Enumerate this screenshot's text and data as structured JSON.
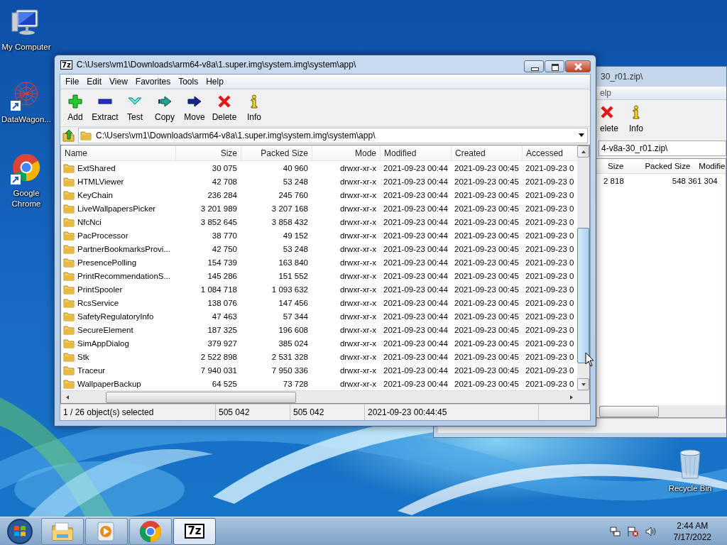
{
  "desktop_icons": [
    {
      "label": "My Computer",
      "kind": "computer"
    },
    {
      "label": "DataWagon...",
      "kind": "datawagon"
    },
    {
      "label": "Google Chrome",
      "kind": "chrome"
    },
    {
      "label": "Recycle Bin",
      "kind": "recycle"
    }
  ],
  "back_window": {
    "title": "30_r01.zip\\",
    "menu": [
      "elp"
    ],
    "toolbar": [
      {
        "label": "elete",
        "kind": "delete"
      },
      {
        "label": "Info",
        "kind": "info"
      }
    ],
    "address": "4-v8a-30_r01.zip\\",
    "columns": [
      "Size",
      "Packed Size",
      "Modifie"
    ],
    "rows": [
      [
        "2 818",
        "548 361 304"
      ]
    ]
  },
  "window": {
    "logo": "7z",
    "title": "C:\\Users\\vm1\\Downloads\\arm64-v8a\\1.super.img\\system.img\\system\\app\\",
    "menu": [
      "File",
      "Edit",
      "View",
      "Favorites",
      "Tools",
      "Help"
    ],
    "toolbar": [
      {
        "label": "Add",
        "kind": "add"
      },
      {
        "label": "Extract",
        "kind": "extract"
      },
      {
        "label": "Test",
        "kind": "test"
      },
      {
        "label": "Copy",
        "kind": "copy"
      },
      {
        "label": "Move",
        "kind": "move"
      },
      {
        "label": "Delete",
        "kind": "delete"
      },
      {
        "label": "Info",
        "kind": "info"
      }
    ],
    "address": "C:\\Users\\vm1\\Downloads\\arm64-v8a\\1.super.img\\system.img\\system\\app\\",
    "columns": [
      "Name",
      "Size",
      "Packed Size",
      "Mode",
      "Modified",
      "Created",
      "Accessed"
    ],
    "rows": [
      {
        "name": "ExtShared",
        "size": "30 075",
        "packed_size": "40 960",
        "mode": "drwxr-xr-x",
        "modified": "2021-09-23 00:44",
        "created": "2021-09-23 00:45",
        "accessed": "2021-09-23 0"
      },
      {
        "name": "HTMLViewer",
        "size": "42 708",
        "packed_size": "53 248",
        "mode": "drwxr-xr-x",
        "modified": "2021-09-23 00:44",
        "created": "2021-09-23 00:45",
        "accessed": "2021-09-23 0"
      },
      {
        "name": "KeyChain",
        "size": "236 284",
        "packed_size": "245 760",
        "mode": "drwxr-xr-x",
        "modified": "2021-09-23 00:44",
        "created": "2021-09-23 00:45",
        "accessed": "2021-09-23 0"
      },
      {
        "name": "LiveWallpapersPicker",
        "size": "3 201 989",
        "packed_size": "3 207 168",
        "mode": "drwxr-xr-x",
        "modified": "2021-09-23 00:44",
        "created": "2021-09-23 00:45",
        "accessed": "2021-09-23 0"
      },
      {
        "name": "NfcNci",
        "size": "3 852 645",
        "packed_size": "3 858 432",
        "mode": "drwxr-xr-x",
        "modified": "2021-09-23 00:44",
        "created": "2021-09-23 00:45",
        "accessed": "2021-09-23 0"
      },
      {
        "name": "PacProcessor",
        "size": "38 770",
        "packed_size": "49 152",
        "mode": "drwxr-xr-x",
        "modified": "2021-09-23 00:44",
        "created": "2021-09-23 00:45",
        "accessed": "2021-09-23 0"
      },
      {
        "name": "PartnerBookmarksProvi...",
        "size": "42 750",
        "packed_size": "53 248",
        "mode": "drwxr-xr-x",
        "modified": "2021-09-23 00:44",
        "created": "2021-09-23 00:45",
        "accessed": "2021-09-23 0"
      },
      {
        "name": "PresencePolling",
        "size": "154 739",
        "packed_size": "163 840",
        "mode": "drwxr-xr-x",
        "modified": "2021-09-23 00:44",
        "created": "2021-09-23 00:45",
        "accessed": "2021-09-23 0"
      },
      {
        "name": "PrintRecommendationS...",
        "size": "145 286",
        "packed_size": "151 552",
        "mode": "drwxr-xr-x",
        "modified": "2021-09-23 00:44",
        "created": "2021-09-23 00:45",
        "accessed": "2021-09-23 0"
      },
      {
        "name": "PrintSpooler",
        "size": "1 084 718",
        "packed_size": "1 093 632",
        "mode": "drwxr-xr-x",
        "modified": "2021-09-23 00:44",
        "created": "2021-09-23 00:45",
        "accessed": "2021-09-23 0"
      },
      {
        "name": "RcsService",
        "size": "138 076",
        "packed_size": "147 456",
        "mode": "drwxr-xr-x",
        "modified": "2021-09-23 00:44",
        "created": "2021-09-23 00:45",
        "accessed": "2021-09-23 0"
      },
      {
        "name": "SafetyRegulatoryInfo",
        "size": "47 463",
        "packed_size": "57 344",
        "mode": "drwxr-xr-x",
        "modified": "2021-09-23 00:44",
        "created": "2021-09-23 00:45",
        "accessed": "2021-09-23 0"
      },
      {
        "name": "SecureElement",
        "size": "187 325",
        "packed_size": "196 608",
        "mode": "drwxr-xr-x",
        "modified": "2021-09-23 00:44",
        "created": "2021-09-23 00:45",
        "accessed": "2021-09-23 0"
      },
      {
        "name": "SimAppDialog",
        "size": "379 927",
        "packed_size": "385 024",
        "mode": "drwxr-xr-x",
        "modified": "2021-09-23 00:44",
        "created": "2021-09-23 00:45",
        "accessed": "2021-09-23 0"
      },
      {
        "name": "Stk",
        "size": "2 522 898",
        "packed_size": "2 531 328",
        "mode": "drwxr-xr-x",
        "modified": "2021-09-23 00:44",
        "created": "2021-09-23 00:45",
        "accessed": "2021-09-23 0"
      },
      {
        "name": "Traceur",
        "size": "7 940 031",
        "packed_size": "7 950 336",
        "mode": "drwxr-xr-x",
        "modified": "2021-09-23 00:44",
        "created": "2021-09-23 00:45",
        "accessed": "2021-09-23 0"
      },
      {
        "name": "WallpaperBackup",
        "size": "64 525",
        "packed_size": "73 728",
        "mode": "drwxr-xr-x",
        "modified": "2021-09-23 00:44",
        "created": "2021-09-23 00:45",
        "accessed": "2021-09-23 0"
      }
    ],
    "status": [
      "1 / 26 object(s) selected",
      "505 042",
      "505 042",
      "2021-09-23 00:44:45"
    ]
  },
  "taskbar": {
    "apps": [
      {
        "kind": "explorer",
        "selected": false
      },
      {
        "kind": "media",
        "selected": false
      },
      {
        "kind": "chrome",
        "selected": false
      },
      {
        "kind": "sevenzip",
        "logo": "7z",
        "selected": true
      }
    ],
    "clock": {
      "time": "2:44 AM",
      "date": "7/17/2022"
    }
  }
}
